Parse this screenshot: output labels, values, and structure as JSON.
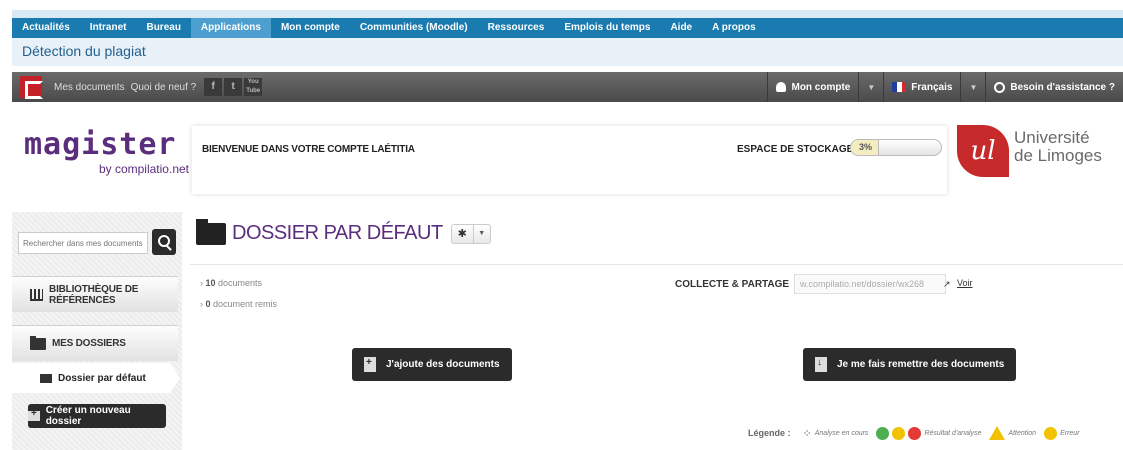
{
  "topnav": {
    "items": [
      "Actualités",
      "Intranet",
      "Bureau",
      "Applications",
      "Mon compte",
      "Communities (Moodle)",
      "Ressources",
      "Emplois du temps",
      "Aide",
      "A propos"
    ]
  },
  "page_title": "Détection du plagiat",
  "toolbar": {
    "my_documents": "Mes documents",
    "whats_new": "Quoi de neuf ?",
    "social": [
      "f",
      "t",
      "You Tube"
    ],
    "account": "Mon compte",
    "language": "Français",
    "help": "Besoin d'assistance ?"
  },
  "header": {
    "brand": "magister",
    "brand_sub": "by compilatio.net",
    "welcome": "BIENVENUE DANS VOTRE COMPTE LAÉTITIA",
    "storage_label": "ESPACE DE STOCKAGE",
    "storage_pct": "3%",
    "storage_value": 0.03,
    "university_line1": "Université",
    "university_line2": "de Limoges"
  },
  "sidebar": {
    "search_placeholder": "Rechercher dans mes documents",
    "library": "BIBLIOTHÈQUE DE RÉFÉRENCES",
    "my_folders": "MES DOSSIERS",
    "default_folder": "Dossier par défaut",
    "new_folder": "Créer un nouveau dossier"
  },
  "main": {
    "folder_title": "DOSSIER PAR DÉFAUT",
    "doc_count": "10",
    "doc_count_label": "documents",
    "remitted_count": "0",
    "remitted_label": "document remis",
    "collecte_label": "COLLECTE & PARTAGE",
    "share_url": "w.compilatio.net/dossier/wx268",
    "voir": "Voir",
    "add_docs": "J'ajoute des documents",
    "request_docs": "Je me fais remettre des documents"
  },
  "legend": {
    "title": "Légende :",
    "in_progress": "Analyse en cours",
    "result": "Résultat d'analyse",
    "attention": "Attention",
    "error": "Erreur",
    "colors": [
      "#4caf50",
      "#f2c200",
      "#e53935"
    ]
  },
  "colors": {
    "nav_blue": "#1a7bb0",
    "brand_purple": "#5b2d7d",
    "uni_red": "#c62a2a"
  }
}
